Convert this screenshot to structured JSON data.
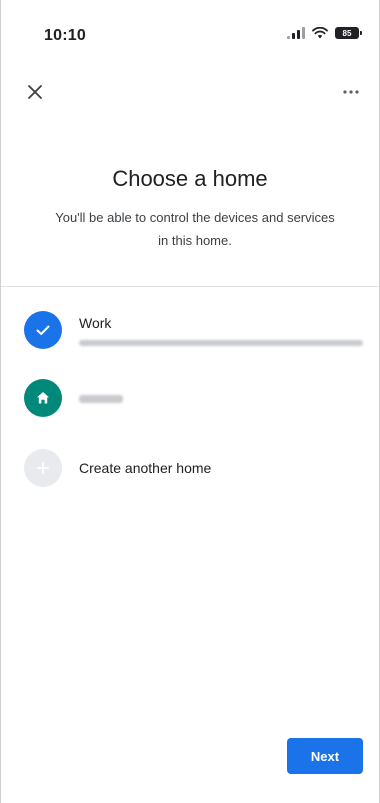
{
  "status_bar": {
    "time": "10:10",
    "battery": "85"
  },
  "header": {
    "title": "Choose a home",
    "subtitle": "You'll be able to control the devices and services in this home."
  },
  "homes": [
    {
      "label": "Work",
      "icon": "check-icon",
      "color": "#1a73e8",
      "selected": true
    },
    {
      "label": "",
      "icon": "house-icon",
      "color": "#00897b",
      "selected": false
    }
  ],
  "create_home": {
    "label": "Create another home",
    "icon": "plus-icon"
  },
  "actions": {
    "next_label": "Next"
  },
  "colors": {
    "accent": "#1a73e8",
    "home_teal": "#00897b"
  }
}
